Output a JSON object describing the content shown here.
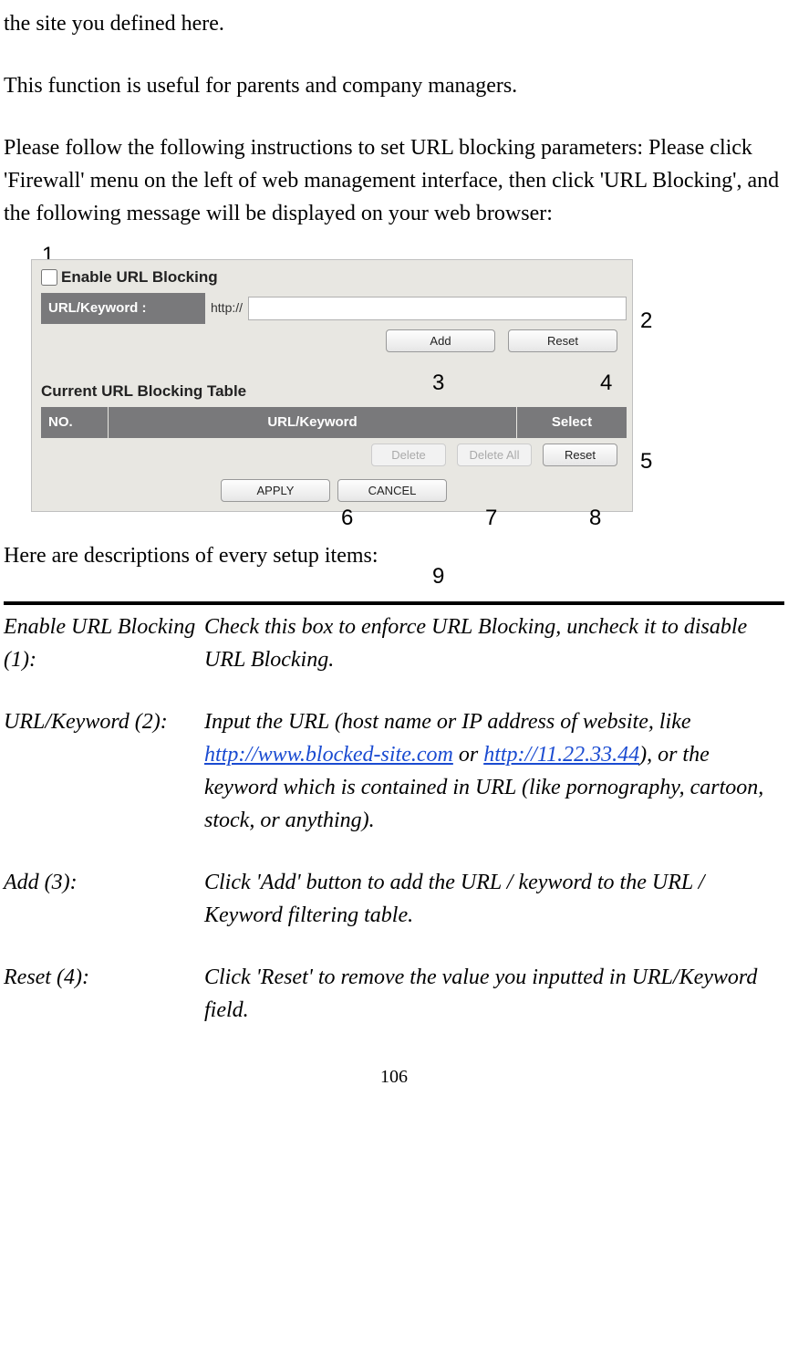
{
  "intro": {
    "p1": "the site you defined here.",
    "p2": "This function is useful for parents and company managers.",
    "p3": "Please follow the following instructions to set URL blocking parameters: Please click 'Firewall' menu on the left of web management interface, then click 'URL Blocking', and the following message will be displayed on your web browser:"
  },
  "ui": {
    "enable_label": "Enable URL Blocking",
    "url_keyword_label": "URL/Keyword :",
    "http_prefix": "http://",
    "url_value": "",
    "add_btn": "Add",
    "reset_btn": "Reset",
    "table_title": "Current URL Blocking Table",
    "th_no": "NO.",
    "th_url": "URL/Keyword",
    "th_select": "Select",
    "delete_btn": "Delete",
    "delete_all_btn": "Delete All",
    "reset2_btn": "Reset",
    "apply_btn": "APPLY",
    "cancel_btn": "CANCEL"
  },
  "annots": {
    "a1": "1",
    "a2": "2",
    "a3": "3",
    "a4": "4",
    "a5": "5",
    "a6": "6",
    "a7": "7",
    "a8": "8",
    "a9": "9"
  },
  "desc_heading": "Here are descriptions of every setup items:",
  "desc": {
    "r1_label": "Enable URL Blocking (1):",
    "r1_value": "Check this box to enforce URL Blocking, uncheck it to disable URL Blocking.",
    "r2_label": "URL/Keyword (2):",
    "r2_pre": "Input the URL (host name or IP address of website, like ",
    "r2_link1": "http://www.blocked-site.com",
    "r2_mid": " or ",
    "r2_link2": "http://11.22.33.44",
    "r2_post": "), or the keyword which is contained in URL (like pornography, cartoon, stock, or anything).",
    "r3_label": "Add (3):",
    "r3_value": "Click 'Add' button to add the URL / keyword to the URL / Keyword filtering table.",
    "r4_label": "Reset (4):",
    "r4_value": "Click 'Reset' to remove the value you inputted in URL/Keyword field."
  },
  "page_num": "106"
}
